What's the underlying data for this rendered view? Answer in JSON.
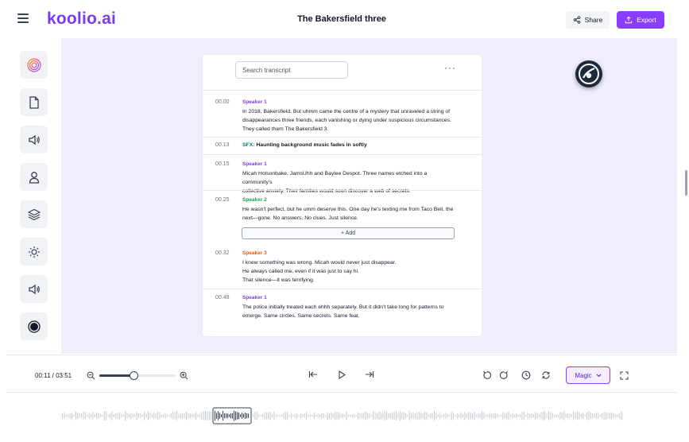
{
  "app": {
    "logo": "koolio.ai",
    "title": "The Bakersfield three"
  },
  "header": {
    "share_label": "Share",
    "export_label": "Export"
  },
  "sidebar": {
    "items": [
      {
        "name": "logo-spiral-icon"
      },
      {
        "name": "document-icon"
      },
      {
        "name": "speaker-icon"
      },
      {
        "name": "user-icon"
      },
      {
        "name": "layers-icon"
      },
      {
        "name": "brightness-icon"
      },
      {
        "name": "speaker-icon"
      },
      {
        "name": "record-icon"
      }
    ]
  },
  "transcript": {
    "search_placeholder": "Search transcript",
    "more_label": "···",
    "add_label": "+ Add",
    "segments": [
      {
        "time": "00.00",
        "speaker": "Speaker 1",
        "lines": [
          "In 2018, Bakersfield,  But uhmm  came the centre of a mystery that unraveled a string of",
          "disappearances three friends, each vanishing or dying under suspicious circumstances.",
          "They called them The Bakersfield 3."
        ]
      },
      {
        "time": "00.13",
        "sfx_label": "SFX:",
        "sfx_text": "Haunting background music fades in softly"
      },
      {
        "time": "00.15",
        "speaker": "Speaker 1",
        "lines": [
          "Micah Holsonbake,  JamsUhh  and Baylee Despot. Three names etched into a community's",
          "collective anxiety. Their families would soon discover a web of secrets."
        ]
      },
      {
        "time": "00.25",
        "speaker": "Speaker 2",
        "lines": [
          "He wasn't perfect, but he umm deserve this. One day he's texting me from Taco Bell, the",
          "next—gone. No answers. No clues. Just silence."
        ]
      },
      {
        "time": "00.32",
        "speaker": "Speaker 3",
        "lines": [
          "I knew something was wrong. Micah would never just disappear.",
          "He always called me, even if it was just to say hi.",
          "That silence—it was terrifying."
        ]
      },
      {
        "time": "00.48",
        "speaker": "Speaker 1",
        "lines": [
          "The police initially treated each ehhh separately. But it didn't take long for patterns to",
          "emerge. Same circles. Same secrets. Same fear."
        ]
      }
    ]
  },
  "player": {
    "current_time": "00:11",
    "total_time": "03:51",
    "time_readout": "00:11 / 03:51",
    "zoom_level": 0.45,
    "magic_label": "Magic"
  },
  "colors": {
    "accent": "#8b3dff",
    "speaker1": "#7c3aed",
    "speaker2": "#16a34a",
    "speaker3": "#ea580c",
    "sfx": "#0f766e",
    "canvas_bg": "#f1eefc"
  }
}
